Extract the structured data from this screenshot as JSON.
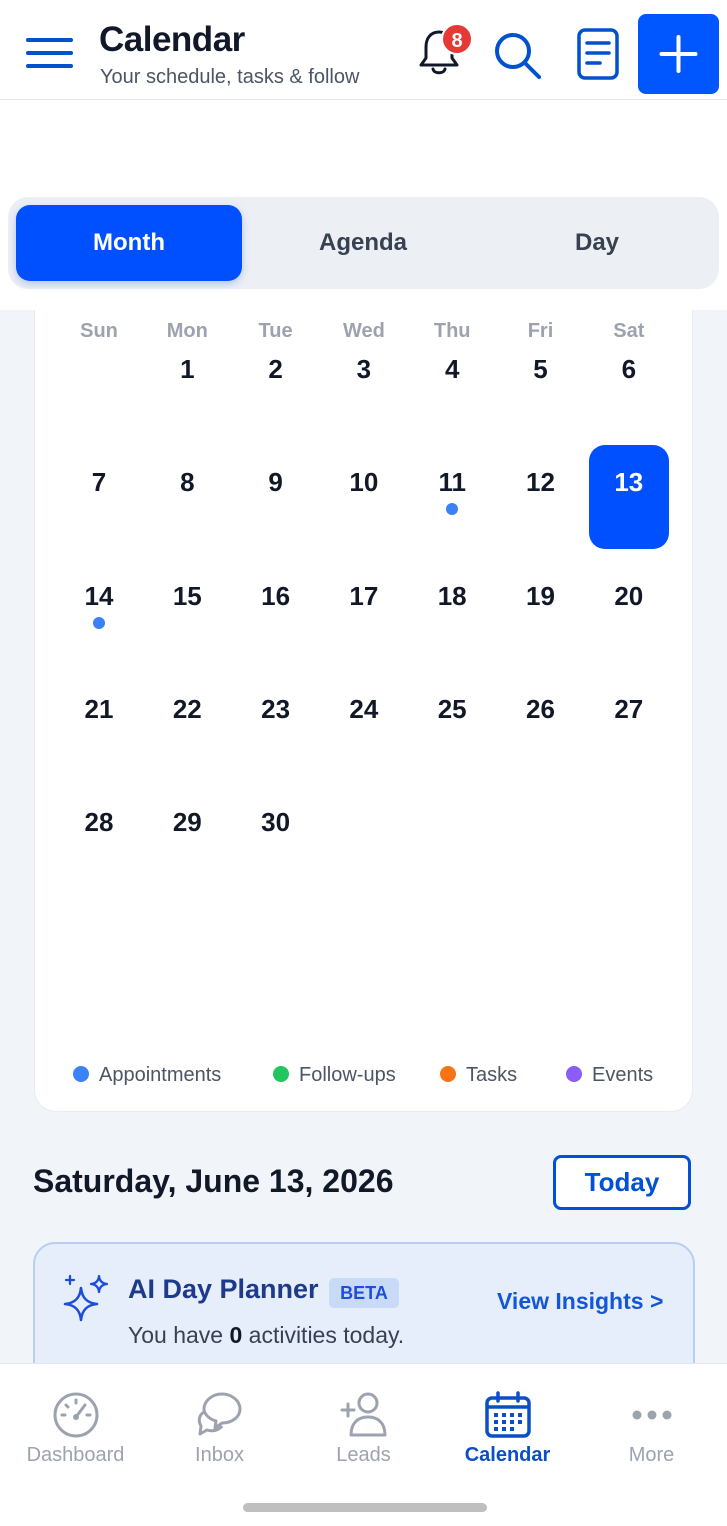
{
  "header": {
    "title": "Calendar",
    "subtitle": "Your schedule, tasks & follow",
    "notification_count": "8",
    "icons": [
      "menu-icon",
      "bell-icon",
      "search-icon",
      "notes-icon",
      "plus-icon"
    ]
  },
  "view_tabs": [
    {
      "label": "Month",
      "active": true
    },
    {
      "label": "Agenda",
      "active": false
    },
    {
      "label": "Day",
      "active": false
    }
  ],
  "calendar": {
    "weekdays": [
      "Sun",
      "Mon",
      "Tue",
      "Wed",
      "Thu",
      "Fri",
      "Sat"
    ],
    "days": [
      "1",
      "2",
      "3",
      "4",
      "5",
      "6",
      "7",
      "8",
      "9",
      "10",
      "11",
      "12",
      "13",
      "14",
      "15",
      "16",
      "17",
      "18",
      "19",
      "20",
      "21",
      "22",
      "23",
      "24",
      "25",
      "26",
      "27",
      "28",
      "29",
      "30"
    ],
    "selected_day": "13",
    "days_with_appointments": [
      "11",
      "14"
    ],
    "legend": [
      {
        "label": "Appointments",
        "color": "#3b82f6"
      },
      {
        "label": "Follow-ups",
        "color": "#22c55e"
      },
      {
        "label": "Tasks",
        "color": "#f97316"
      },
      {
        "label": "Events",
        "color": "#8b5cf6"
      }
    ]
  },
  "date_heading": "Saturday, June 13, 2026",
  "today_button": "Today",
  "ai_planner": {
    "title": "AI Day Planner",
    "badge": "BETA",
    "subtitle_prefix": "You have",
    "count": "0",
    "subtitle_suffix": "activities today.",
    "link": "View Insights >"
  },
  "bottom_nav": [
    {
      "label": "Dashboard",
      "icon": "dashboard-icon",
      "active": false
    },
    {
      "label": "Inbox",
      "icon": "inbox-icon",
      "active": false
    },
    {
      "label": "Leads",
      "icon": "leads-icon",
      "active": false
    },
    {
      "label": "Calendar",
      "icon": "calendar-icon",
      "active": true
    },
    {
      "label": "More",
      "icon": "more-icon",
      "active": false
    }
  ],
  "colors": {
    "accent": "#0050ff",
    "badge": "#e53935"
  }
}
